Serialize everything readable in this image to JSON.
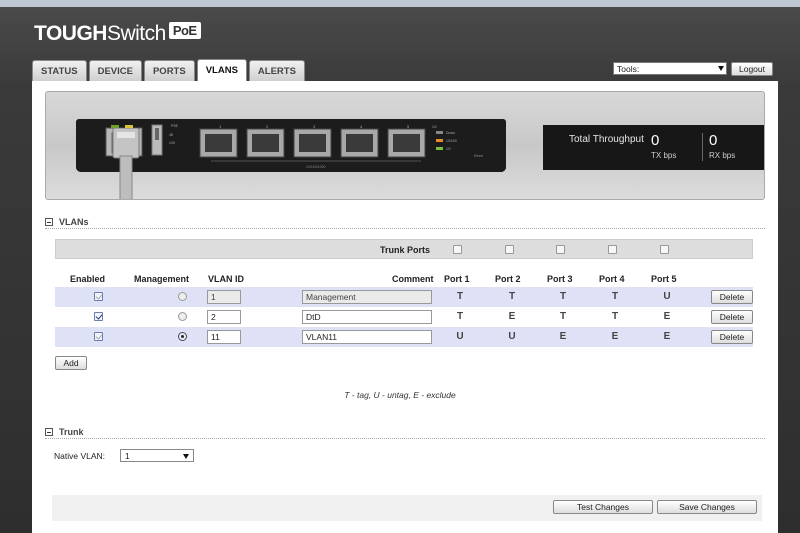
{
  "brand": {
    "name_bold": "TOUGH",
    "name_regular": "Switch",
    "suffix": "PoE"
  },
  "tabs": [
    {
      "label": "STATUS",
      "active": false
    },
    {
      "label": "DEVICE",
      "active": false
    },
    {
      "label": "PORTS",
      "active": false
    },
    {
      "label": "VLANS",
      "active": true
    },
    {
      "label": "ALERTS",
      "active": false
    }
  ],
  "tools": {
    "label": "Tools:"
  },
  "logout": "Logout",
  "throughput": {
    "label": "Total Throughput",
    "tx_value": "0",
    "tx_unit": "TX bps",
    "rx_value": "0",
    "rx_unit": "RX bps"
  },
  "device_labels": {
    "ports": [
      "1",
      "2",
      "3",
      "4",
      "5"
    ],
    "speed": "10/100/1000",
    "legend": [
      "1G",
      "10/100",
      "Down"
    ],
    "pse": "PSE",
    "v48": "48",
    "v24": "24V",
    "reset": "Reset"
  },
  "vlans": {
    "section_title": "VLANs",
    "trunk_ports_label": "Trunk Ports",
    "trunk_ports": [
      false,
      false,
      false,
      false,
      false
    ],
    "headers": {
      "enabled": "Enabled",
      "management": "Management",
      "vlan_id": "VLAN ID",
      "comment": "Comment",
      "ports": [
        "Port 1",
        "Port 2",
        "Port 3",
        "Port 4",
        "Port 5"
      ]
    },
    "rows": [
      {
        "enabled": true,
        "enabled_disabled": true,
        "management": false,
        "vlan_id": "1",
        "vlan_readonly": true,
        "comment": "Management",
        "ports": [
          "T",
          "T",
          "T",
          "T",
          "U"
        ],
        "delete": "Delete"
      },
      {
        "enabled": true,
        "enabled_disabled": false,
        "management": false,
        "vlan_id": "2",
        "vlan_readonly": false,
        "comment": "DtD",
        "ports": [
          "T",
          "E",
          "T",
          "T",
          "E"
        ],
        "delete": "Delete"
      },
      {
        "enabled": true,
        "enabled_disabled": true,
        "management": true,
        "vlan_id": "11",
        "vlan_readonly": false,
        "comment": "VLAN11",
        "ports": [
          "U",
          "U",
          "E",
          "E",
          "E"
        ],
        "delete": "Delete"
      }
    ],
    "add_label": "Add",
    "legend": "T - tag, U - untag, E - exclude"
  },
  "trunk": {
    "section_title": "Trunk",
    "native_vlan_label": "Native VLAN:",
    "native_vlan_value": "1"
  },
  "footer": {
    "test_label": "Test Changes",
    "save_label": "Save Changes"
  }
}
